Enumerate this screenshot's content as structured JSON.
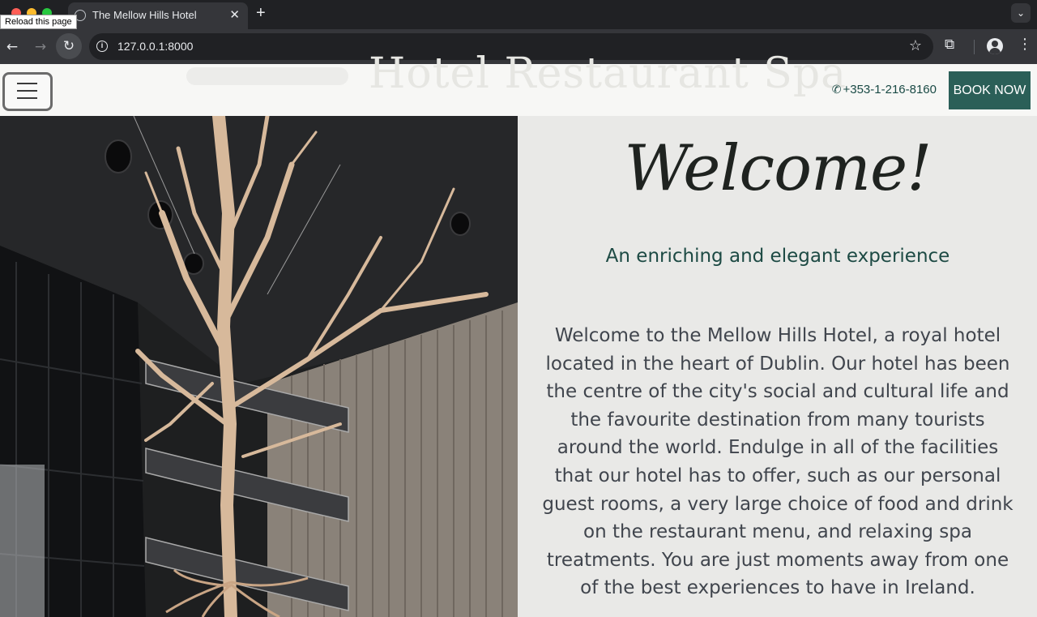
{
  "browser": {
    "tab_title": "The Mellow Hills Hotel",
    "tooltip": "Reload this page",
    "url": "127.0.0.1:8000",
    "new_tab": "+",
    "tab_close": "✕"
  },
  "header": {
    "phone": "+353-1-216-8160",
    "book_now": "BOOK NOW",
    "ghost_text": "Hotel   Restaurant   Spa"
  },
  "main": {
    "welcome_heading": "Welcome!",
    "subtitle": "An enriching and elegant experience",
    "body": "Welcome to the Mellow Hills Hotel, a royal hotel located in the heart of Dublin. Our hotel has been the centre of the city's social and cultural life and the favourite destination from many tourists around the world. Endulge in all of the facilities that our hotel has to offer, such as our personal guest rooms, a very large choice of food and drink on the restaurant menu, and relaxing spa treatments. You are just moments away from one of the best experiences to have in Ireland."
  },
  "colors": {
    "accent": "#2b5f58",
    "subtitle": "#1d4a44",
    "page_bg": "#e9e9e7"
  },
  "icons": [
    "favicon-globe-icon",
    "back-arrow-icon",
    "forward-arrow-icon",
    "reload-icon",
    "info-icon",
    "star-icon",
    "extensions-icon",
    "profile-icon",
    "menu-dots-icon",
    "hamburger-menu-icon",
    "phone-icon"
  ]
}
